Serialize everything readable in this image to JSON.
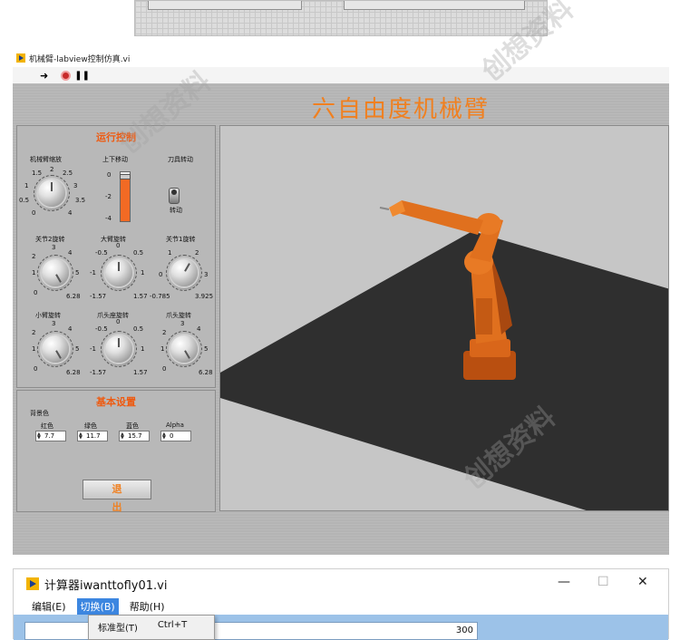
{
  "labview": {
    "window_title": "机械臂-labview控制仿真.vi",
    "main_title": "六自由度机械臂",
    "control_box": {
      "title": "运行控制",
      "zoom": {
        "label": "机械臂缩放",
        "scale": [
          "0",
          "0.5",
          "1",
          "1.5",
          "2",
          "2.5",
          "3",
          "3.5",
          "4"
        ],
        "value": 2
      },
      "updown": {
        "label": "上下移动",
        "scale": [
          "0",
          "-2",
          "-4"
        ],
        "value": -0.4
      },
      "tool": {
        "label": "刀具转动",
        "state_label": "转动"
      },
      "joint2": {
        "label": "关节2旋转",
        "scale": [
          "0",
          "1",
          "2",
          "3",
          "4",
          "5",
          "6.28"
        ]
      },
      "bigarm": {
        "label": "大臂旋转",
        "scale": [
          "-1.57",
          "-1",
          "-0.5",
          "0",
          "0.5",
          "1",
          "1.57"
        ]
      },
      "joint1": {
        "label": "关节1旋转",
        "scale": [
          "-0.785",
          "0",
          "1",
          "2",
          "3",
          "3.925"
        ]
      },
      "smallarm": {
        "label": "小臂旋转",
        "scale": [
          "0",
          "1",
          "2",
          "3",
          "4",
          "5",
          "6.28"
        ]
      },
      "claw_base": {
        "label": "爪头座旋转",
        "scale": [
          "-1.57",
          "-1",
          "-0.5",
          "0",
          "0.5",
          "1",
          "1.57"
        ]
      },
      "claw": {
        "label": "爪头旋转",
        "scale": [
          "0",
          "1",
          "2",
          "3",
          "4",
          "5",
          "6.28"
        ]
      }
    },
    "settings_box": {
      "title": "基本设置",
      "bg_label": "背景色",
      "inputs": [
        {
          "label": "红色",
          "value": "7.7"
        },
        {
          "label": "绿色",
          "value": "11.7"
        },
        {
          "label": "蓝色",
          "value": "15.7"
        },
        {
          "label": "Alpha",
          "value": "0"
        }
      ],
      "exit_label": "退出"
    },
    "colors": {
      "accent": "#f08020",
      "arm": "#e0701e",
      "floor": "#2f2f2f"
    }
  },
  "calculator": {
    "window_title": "计算器iwanttofly01.vi",
    "menu": [
      "编辑(E)",
      "切换(B)",
      "帮助(H)"
    ],
    "display_value": "300",
    "dropdown_item": {
      "label": "标准型(T)",
      "shortcut": "Ctrl+T"
    }
  },
  "watermark": "创想资料"
}
